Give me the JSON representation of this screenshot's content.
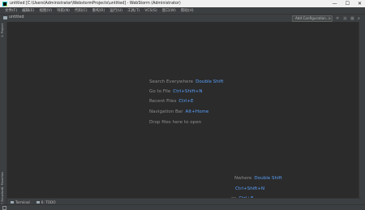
{
  "window": {
    "title": "untitled [C:\\Users\\Administrator\\WebstormProjects\\untitled] - WebStorm (Administrator)",
    "minimize": "—",
    "maximize": "☐",
    "close": "✕"
  },
  "menu": [
    "文件(F)",
    "编辑(E)",
    "视图(V)",
    "导航(N)",
    "代码(C)",
    "重构(R)",
    "运行(U)",
    "工具(T)",
    "VCS(S)",
    "窗口(W)",
    "帮助(H)"
  ],
  "navbar": {
    "breadcrumb": "untitled",
    "add_configuration": "Add Configuration...",
    "icons": [
      "run-icon",
      "debug-icon",
      "coverage-icon",
      "stop-icon",
      "search-icon"
    ]
  },
  "left_stripe": {
    "project": "1: Project",
    "favorites": "2: Favorites",
    "structure": "7: Structure"
  },
  "hints": [
    {
      "label": "Search Everywhere",
      "key": "Double Shift"
    },
    {
      "label": "Go to File",
      "key": "Ctrl+Shift+N"
    },
    {
      "label": "Recent Files",
      "key": "Ctrl+E"
    },
    {
      "label": "Navigation Bar",
      "key": "Alt+Home"
    },
    {
      "label": "Drop files here to open",
      "key": ""
    }
  ],
  "ghost_hints": [
    {
      "label": "Nwhere",
      "key": "Double Shift"
    },
    {
      "label": "",
      "key": "Ctrl+Shift+N"
    },
    {
      "label": "es",
      "key": "Ctrl+E"
    }
  ],
  "bottom_tabs": [
    {
      "label": "Terminal",
      "icon": "terminal-icon"
    },
    {
      "label": "6: TODO",
      "icon": "todo-icon"
    }
  ]
}
